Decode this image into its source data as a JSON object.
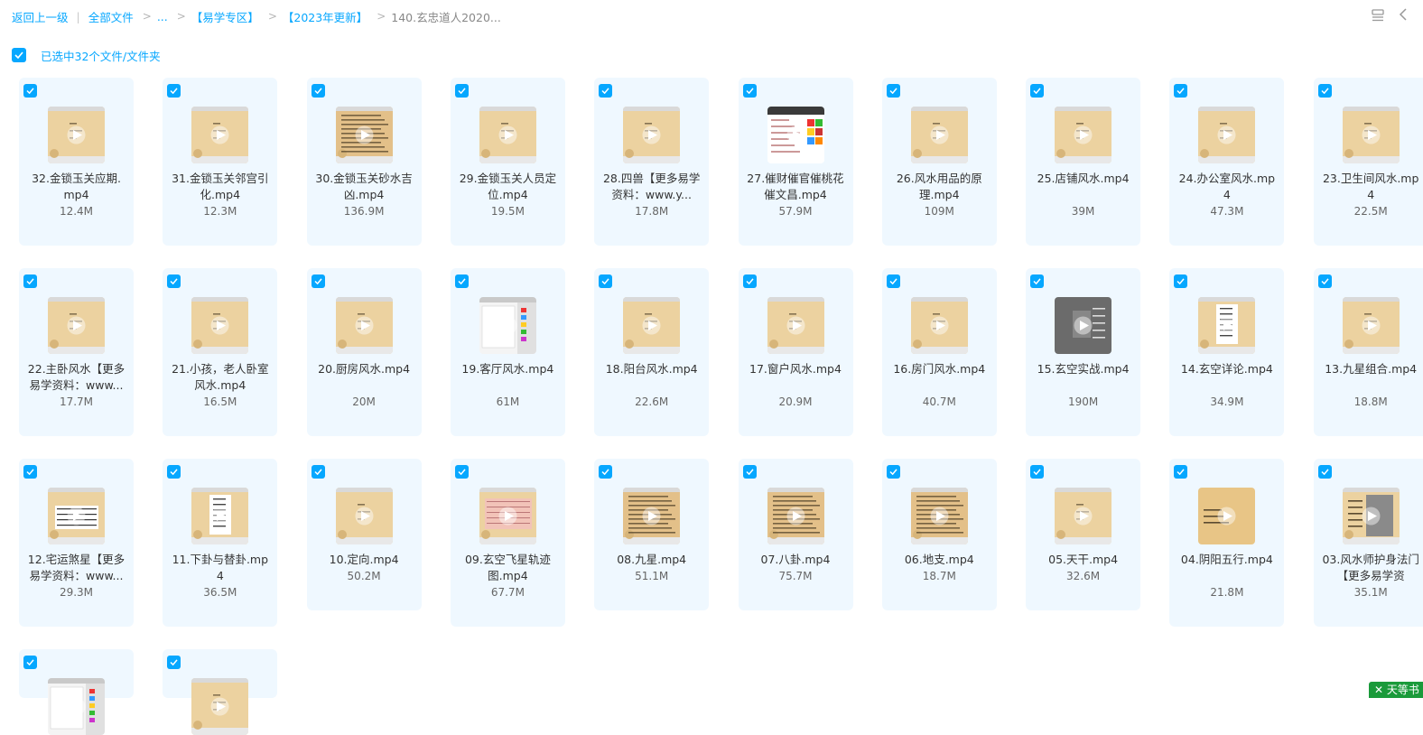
{
  "breadcrumb": {
    "back": "返回上一级",
    "all_files": "全部文件",
    "ellipsis": "...",
    "yixue": "【易学专区】",
    "update2023": "【2023年更新】",
    "current": "140.玄忠道人2020..."
  },
  "selection": {
    "text": "已选中32个文件/文件夹"
  },
  "files": [
    {
      "name": "32.金锁玉关应期.mp4",
      "size": "12.4M",
      "thumb": "slide"
    },
    {
      "name": "31.金锁玉关邻宫引化.mp4",
      "size": "12.3M",
      "thumb": "slide"
    },
    {
      "name": "30.金锁玉关砂水吉凶.mp4",
      "size": "136.9M",
      "thumb": "text"
    },
    {
      "name": "29.金锁玉关人员定位.mp4",
      "size": "19.5M",
      "thumb": "slide"
    },
    {
      "name": "28.四兽【更多易学资料：www.y...",
      "size": "17.8M",
      "thumb": "slide"
    },
    {
      "name": "27.催财催官催桃花催文昌.mp4",
      "size": "57.9M",
      "thumb": "chart"
    },
    {
      "name": "26.风水用品的原理.mp4",
      "size": "109M",
      "thumb": "slide"
    },
    {
      "name": "25.店铺风水.mp4",
      "size": "39M",
      "thumb": "slide"
    },
    {
      "name": "24.办公室风水.mp4",
      "size": "47.3M",
      "thumb": "slide"
    },
    {
      "name": "23.卫生间风水.mp4",
      "size": "22.5M",
      "thumb": "slide"
    },
    {
      "name": "22.主卧风水【更多易学资料：www...",
      "size": "17.7M",
      "thumb": "slide"
    },
    {
      "name": "21.小孩，老人卧室风水.mp4",
      "size": "16.5M",
      "thumb": "slide"
    },
    {
      "name": "20.厨房风水.mp4",
      "size": "20M",
      "thumb": "slide"
    },
    {
      "name": "19.客厅风水.mp4",
      "size": "61M",
      "thumb": "screen"
    },
    {
      "name": "18.阳台风水.mp4",
      "size": "22.6M",
      "thumb": "slide"
    },
    {
      "name": "17.窗户风水.mp4",
      "size": "20.9M",
      "thumb": "slide"
    },
    {
      "name": "16.房门风水.mp4",
      "size": "40.7M",
      "thumb": "slide"
    },
    {
      "name": "15.玄空实战.mp4",
      "size": "190M",
      "thumb": "gray"
    },
    {
      "name": "14.玄空详论.mp4",
      "size": "34.9M",
      "thumb": "paper"
    },
    {
      "name": "13.九星组合.mp4",
      "size": "18.8M",
      "thumb": "slide"
    },
    {
      "name": "12.宅运煞星【更多易学资料：www...",
      "size": "29.3M",
      "thumb": "table"
    },
    {
      "name": "11.下卦与替卦.mp4",
      "size": "36.5M",
      "thumb": "paper"
    },
    {
      "name": "10.定向.mp4",
      "size": "50.2M",
      "thumb": "slide"
    },
    {
      "name": "09.玄空飞星轨迹图.mp4",
      "size": "67.7M",
      "thumb": "pink"
    },
    {
      "name": "08.九星.mp4",
      "size": "51.1M",
      "thumb": "text"
    },
    {
      "name": "07.八卦.mp4",
      "size": "75.7M",
      "thumb": "text"
    },
    {
      "name": "06.地支.mp4",
      "size": "18.7M",
      "thumb": "text"
    },
    {
      "name": "05.天干.mp4",
      "size": "32.6M",
      "thumb": "slide"
    },
    {
      "name": "04.阴阳五行.mp4",
      "size": "21.8M",
      "thumb": "plain"
    },
    {
      "name": "03.风水师护身法门【更多易学资",
      "size": "35.1M",
      "thumb": "photo"
    },
    {
      "name": "",
      "size": "",
      "thumb": "screen"
    },
    {
      "name": "",
      "size": "",
      "thumb": "slide"
    }
  ],
  "icons": {
    "view": "list-view-icon",
    "collapse": "chevron-left-icon",
    "check": "check-icon",
    "play": "play-icon"
  },
  "colors": {
    "accent": "#06a7ff",
    "card_bg": "#eff8ff",
    "thumb_bg": "#ecd2a0"
  },
  "ad": {
    "label": "✕ 天等书"
  }
}
